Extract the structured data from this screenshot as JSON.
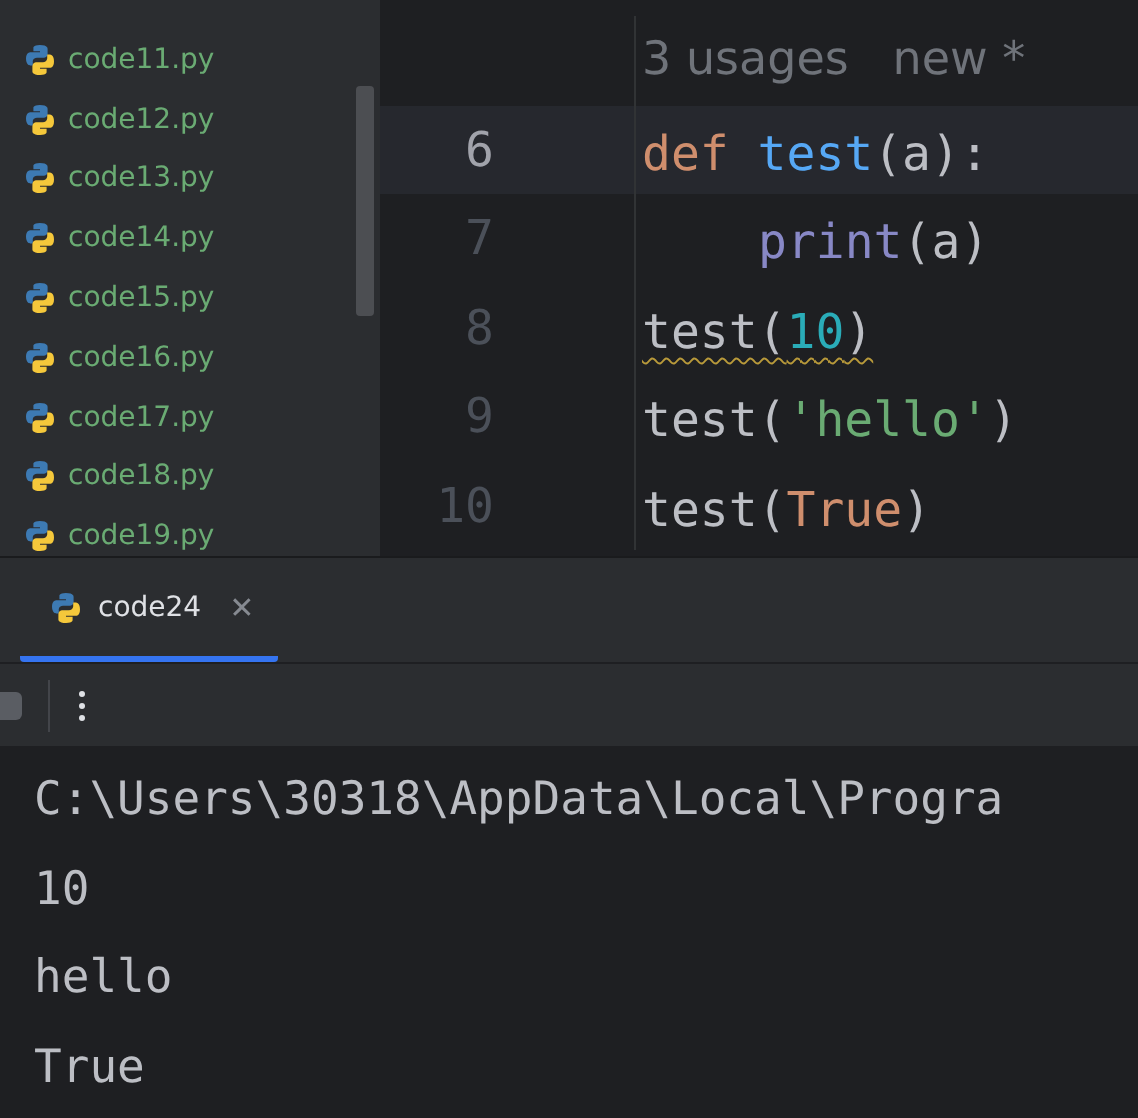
{
  "project_tree": {
    "files": [
      {
        "name": "code11.py"
      },
      {
        "name": "code12.py"
      },
      {
        "name": "code13.py"
      },
      {
        "name": "code14.py"
      },
      {
        "name": "code15.py"
      },
      {
        "name": "code16.py"
      },
      {
        "name": "code17.py"
      },
      {
        "name": "code18.py"
      },
      {
        "name": "code19.py"
      }
    ]
  },
  "editor": {
    "inlay_hint": "3 usages   new *",
    "lines": [
      {
        "number": "6",
        "current": true,
        "tokens": [
          {
            "kind": "keyword",
            "text": "def "
          },
          {
            "kind": "function",
            "text": "test"
          },
          {
            "kind": "plain",
            "text": "(a):"
          }
        ]
      },
      {
        "number": "7",
        "current": false,
        "indented": true,
        "tokens": [
          {
            "kind": "builtin",
            "text": "print"
          },
          {
            "kind": "plain",
            "text": "(a)"
          }
        ]
      },
      {
        "number": "8",
        "current": false,
        "warning": true,
        "tokens": [
          {
            "kind": "plain",
            "text": "test("
          },
          {
            "kind": "number",
            "text": "10"
          },
          {
            "kind": "plain",
            "text": ")"
          }
        ]
      },
      {
        "number": "9",
        "current": false,
        "tokens": [
          {
            "kind": "plain",
            "text": "test("
          },
          {
            "kind": "string",
            "text": "'hello'"
          },
          {
            "kind": "plain",
            "text": ")"
          }
        ]
      },
      {
        "number": "10",
        "current": false,
        "tokens": [
          {
            "kind": "plain",
            "text": "test("
          },
          {
            "kind": "keyword",
            "text": "True"
          },
          {
            "kind": "plain",
            "text": ")"
          }
        ]
      }
    ]
  },
  "run_panel": {
    "tabs": [
      {
        "label": "code24",
        "selected": true,
        "close": "✕"
      }
    ],
    "console": [
      "C:\\Users\\30318\\AppData\\Local\\Progra",
      "10",
      "hello",
      "True"
    ]
  }
}
